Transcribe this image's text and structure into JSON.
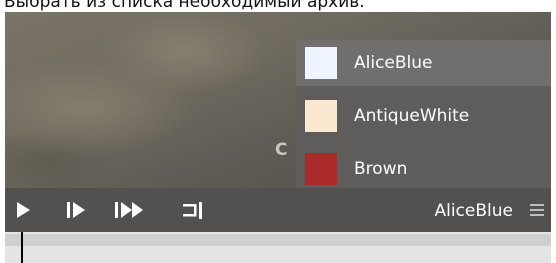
{
  "caption": "Выбрать из списка необходимый архив.",
  "video": {
    "overlay_letter": "C"
  },
  "dropdown": {
    "items": [
      {
        "label": "AliceBlue",
        "color": "#eef5ff",
        "selected": true
      },
      {
        "label": "AntiqueWhite",
        "color": "#fbe6cf",
        "selected": false
      },
      {
        "label": "Brown",
        "color": "#ad2a2a",
        "selected": false
      }
    ]
  },
  "controls": {
    "icons": [
      "play-icon",
      "step-forward-icon",
      "fast-forward-icon",
      "jump-to-end-icon"
    ],
    "current_archive": "AliceBlue"
  },
  "colors": {
    "panel": "#525150",
    "dropdown": "#5e5d5c",
    "selected": "#706f6e"
  }
}
